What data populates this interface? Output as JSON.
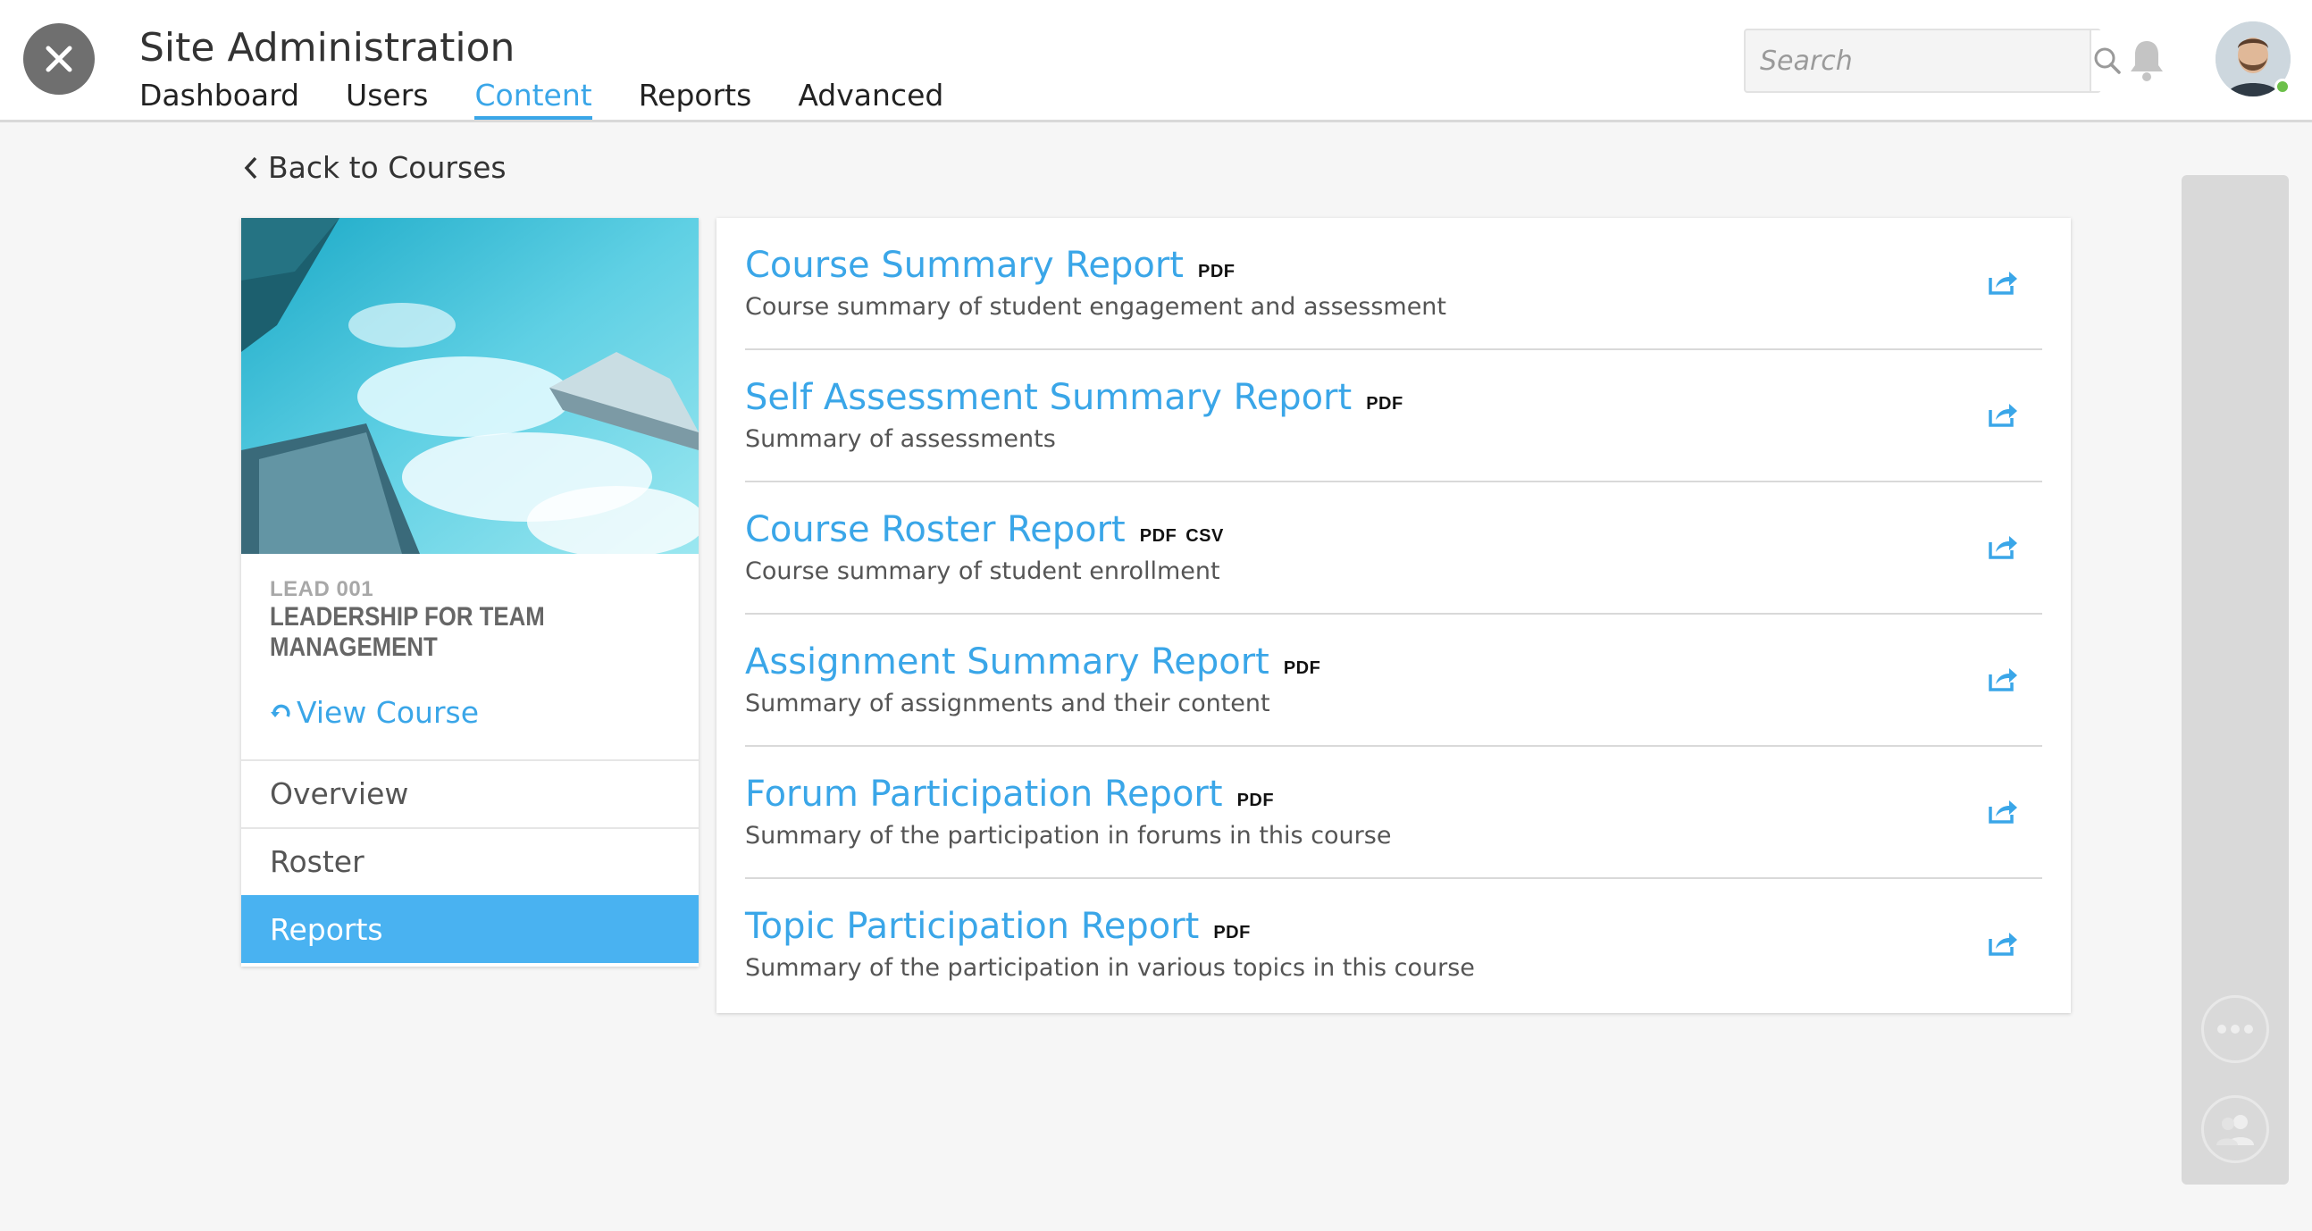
{
  "header": {
    "title": "Site Administration",
    "tabs": [
      {
        "label": "Dashboard"
      },
      {
        "label": "Users"
      },
      {
        "label": "Content",
        "active": true
      },
      {
        "label": "Reports"
      },
      {
        "label": "Advanced"
      }
    ],
    "search_placeholder": "Search"
  },
  "back_link": "Back to Courses",
  "course": {
    "code": "LEAD 001",
    "name": "LEADERSHIP FOR TEAM MANAGEMENT",
    "view_label": "View Course",
    "menu": [
      {
        "label": "Overview"
      },
      {
        "label": "Roster"
      },
      {
        "label": "Reports",
        "active": true
      }
    ]
  },
  "reports": [
    {
      "title": "Course Summary Report",
      "formats": [
        "PDF"
      ],
      "description": "Course summary of student engagement and assessment"
    },
    {
      "title": "Self Assessment Summary Report",
      "formats": [
        "PDF"
      ],
      "description": "Summary of assessments"
    },
    {
      "title": "Course Roster Report",
      "formats": [
        "PDF",
        "CSV"
      ],
      "description": "Course summary of student enrollment"
    },
    {
      "title": "Assignment Summary Report",
      "formats": [
        "PDF"
      ],
      "description": "Summary of assignments and their content"
    },
    {
      "title": "Forum Participation Report",
      "formats": [
        "PDF"
      ],
      "description": "Summary of the participation in forums in this course"
    },
    {
      "title": "Topic Participation Report",
      "formats": [
        "PDF"
      ],
      "description": "Summary of the participation in various topics in this course"
    }
  ],
  "icons": {
    "close": "close-icon",
    "search": "search-icon",
    "notifications": "bell-icon",
    "back": "chevron-left-icon",
    "view_course": "refresh-icon",
    "export": "export-icon",
    "more": "more-icon",
    "people": "people-icon"
  },
  "colors": {
    "accent": "#3aa6e8",
    "active_menu": "#49b2f1",
    "online": "#6cc04a"
  }
}
